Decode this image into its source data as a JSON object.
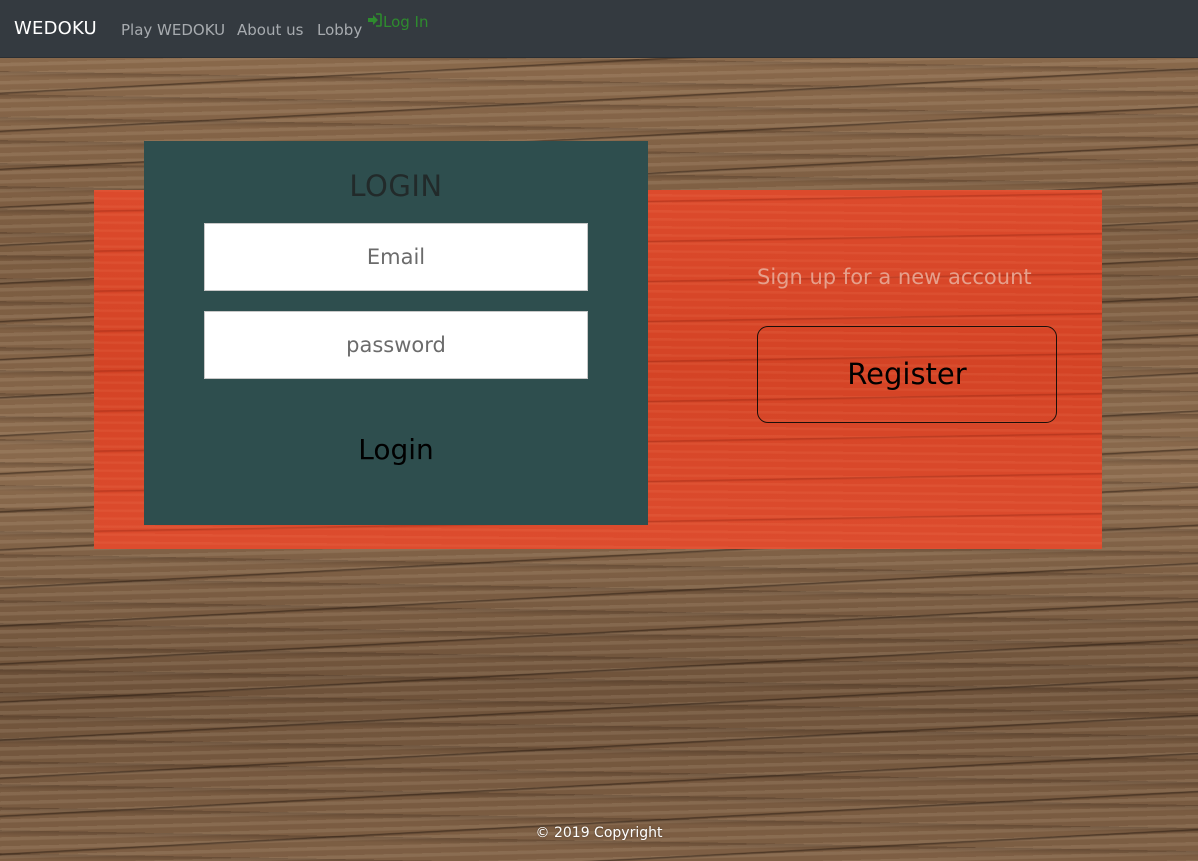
{
  "navbar": {
    "brand": "WEDOKU",
    "links": {
      "play": "Play WEDOKU",
      "about": "About us",
      "lobby": "Lobby",
      "login": "Log In"
    },
    "login_icon": "sign-in-icon",
    "login_color": "#2e8b2e"
  },
  "login": {
    "title": "LOGIN",
    "email_placeholder": "Email",
    "email_value": "",
    "password_placeholder": "password",
    "password_value": "",
    "submit_label": "Login"
  },
  "signup": {
    "prompt": "Sign up for a new account",
    "register_label": "Register"
  },
  "footer": {
    "copyright": "© 2019 Copyright"
  },
  "colors": {
    "navbar": "#343a40",
    "card": "#2e4e4e",
    "accent_panel": "#d9472a"
  }
}
